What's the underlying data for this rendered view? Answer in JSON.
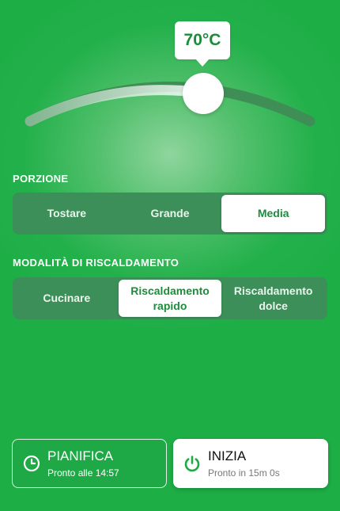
{
  "temperature": {
    "label": "70°C",
    "fraction": 0.55
  },
  "portion": {
    "title": "PORZIONE",
    "options": [
      "Tostare",
      "Grande",
      "Media"
    ],
    "selected": "Media"
  },
  "heating_mode": {
    "title": "MODALITÀ DI RISCALDAMENTO",
    "options": [
      "Cucinare",
      "Riscaldamento rapido",
      "Riscaldamento dolce"
    ],
    "selected": "Riscaldamento rapido"
  },
  "actions": {
    "schedule": {
      "title": "PIANIFICA",
      "subtitle": "Pronto alle 14:57",
      "icon": "clock-icon"
    },
    "start": {
      "title": "INIZIA",
      "subtitle": "Pronto in 15m 0s",
      "icon": "power-icon"
    }
  },
  "colors": {
    "brand_green": "#1fae46",
    "active_text": "#1c8c3b",
    "segment_bg": "#3c8f58"
  }
}
